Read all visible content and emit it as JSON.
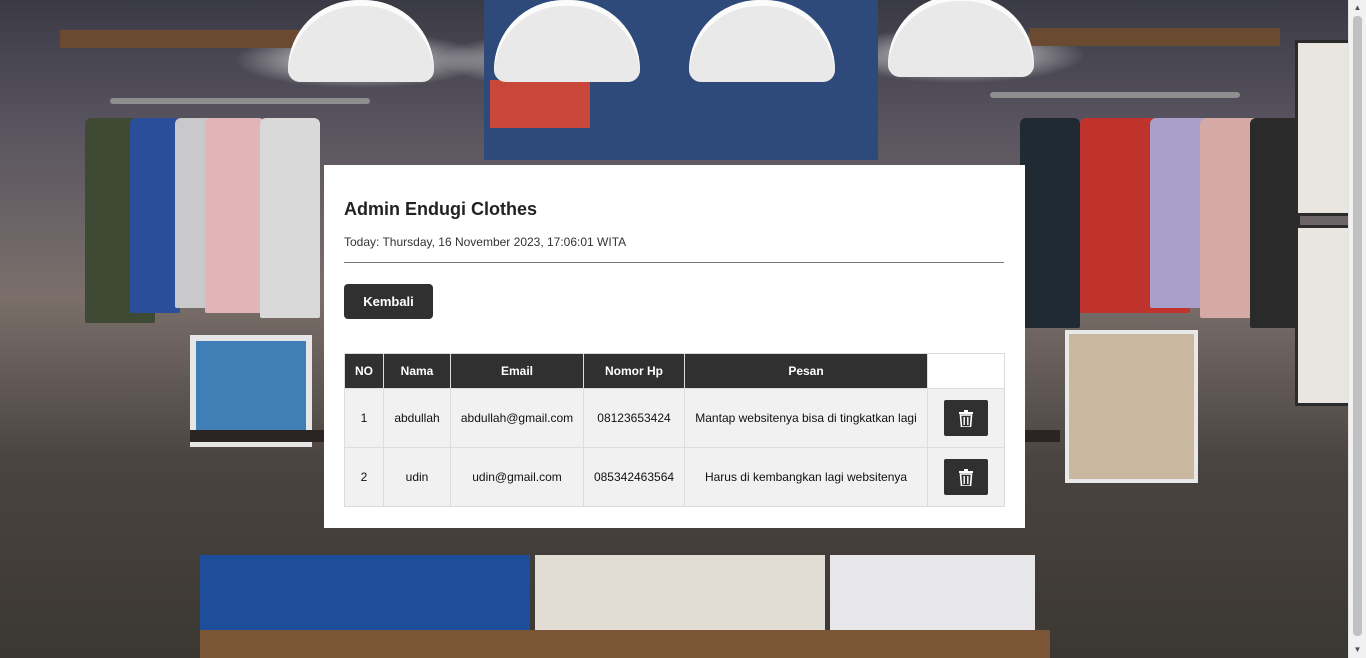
{
  "page": {
    "title": "Admin Endugi Clothes",
    "today_text": "Today: Thursday, 16 November 2023, 17:06:01 WITA",
    "back_button_label": "Kembali"
  },
  "table": {
    "headers": [
      "NO",
      "Nama",
      "Email",
      "Nomor Hp",
      "Pesan"
    ],
    "rows": [
      {
        "no": "1",
        "nama": "abdullah",
        "email": "abdullah@gmail.com",
        "nomor_hp": "08123653424",
        "pesan": "Mantap websitenya bisa di tingkatkan lagi",
        "action_icon": "trash-icon"
      },
      {
        "no": "2",
        "nama": "udin",
        "email": "udin@gmail.com",
        "nomor_hp": "085342463564",
        "pesan": "Harus di kembangkan lagi websitenya",
        "action_icon": "trash-icon"
      }
    ]
  },
  "colors": {
    "dark": "#303030",
    "panel": "#ffffff",
    "row_bg": "#f1f1f1"
  }
}
